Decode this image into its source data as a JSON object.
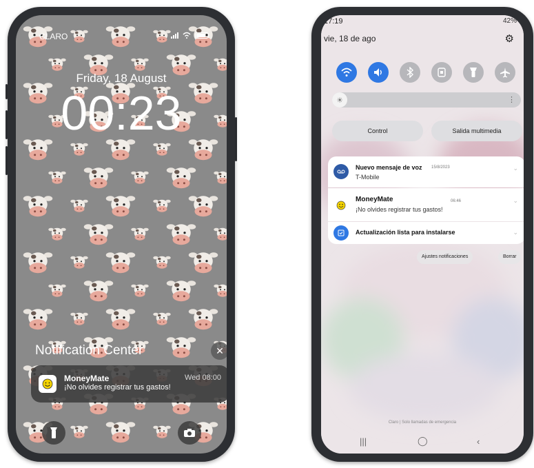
{
  "iphone": {
    "carrier": "CLARO",
    "date": "Friday, 18 August",
    "time": "00:23",
    "notification_center_title": "Notification Center",
    "notification": {
      "app": "MoneyMate",
      "message": "¡No olvides registrar tus gastos!",
      "time": "Wed 08:00",
      "icon": "smiley-icon"
    },
    "wallpaper_icon": "cow-face-emoji"
  },
  "android": {
    "status_time": "17:19",
    "status_right": "42%",
    "date": "vie, 18 de ago",
    "quick_settings": [
      {
        "name": "wifi",
        "on": true
      },
      {
        "name": "sound",
        "on": true
      },
      {
        "name": "bluetooth",
        "on": false
      },
      {
        "name": "portrait-lock",
        "on": false
      },
      {
        "name": "flashlight",
        "on": false
      },
      {
        "name": "airplane-mode",
        "on": false
      }
    ],
    "control_label": "Control",
    "media_output_label": "Salida multimedia",
    "notifications": [
      {
        "title": "Nuevo mensaje de voz",
        "date": "15/8/2023",
        "subtitle": "T-Mobile",
        "icon": "voicemail-icon"
      },
      {
        "title": "MoneyMate",
        "date": "06:46",
        "subtitle": "¡No olvides registrar tus gastos!",
        "icon": "smiley-icon"
      },
      {
        "title": "Actualización lista para instalarse",
        "date": "",
        "subtitle": "",
        "icon": "update-icon"
      }
    ],
    "notification_settings_label": "Ajustes notificaciones",
    "clear_label": "Borrar",
    "footer": "Claro | Solo llamadas de emergencia",
    "colors": {
      "accent": "#2f78e3",
      "frame": "#2d2f33",
      "ios_wallpaper": "#8a8a8a"
    }
  }
}
